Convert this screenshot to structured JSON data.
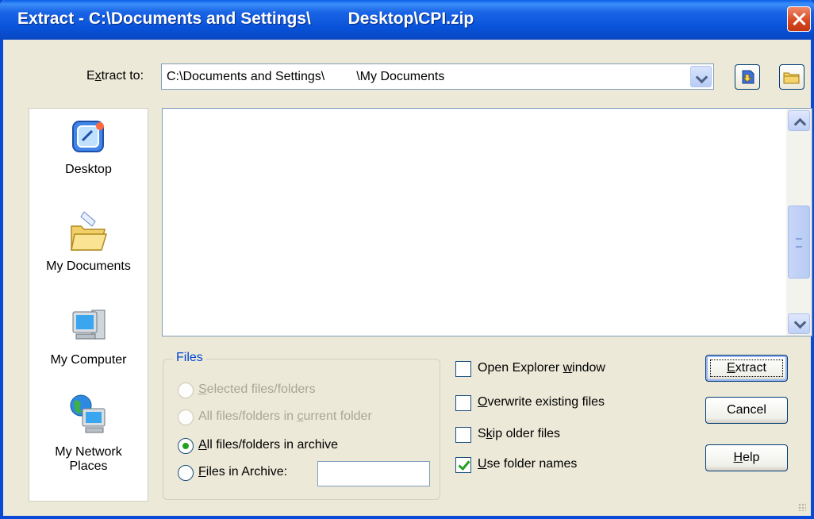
{
  "window": {
    "title": "Extract - C:\\Documents and Settings\\        Desktop\\CPI.zip",
    "close_label": "×"
  },
  "extract_to": {
    "label_pre": "E",
    "label_ul": "x",
    "label_post": "tract to:",
    "value": "C:\\Documents and Settings\\         \\My Documents"
  },
  "toolbar": {
    "up_icon": "up-folder-icon",
    "new_folder_icon": "new-folder-icon"
  },
  "places": [
    {
      "label": "Desktop",
      "icon": "desktop-icon"
    },
    {
      "label": "My Documents",
      "icon": "my-documents-icon"
    },
    {
      "label": "My Computer",
      "icon": "my-computer-icon"
    },
    {
      "label": "My Network\nPlaces",
      "line1": "My Network",
      "line2": "Places",
      "icon": "network-places-icon"
    }
  ],
  "files_group": {
    "legend": "Files",
    "options": [
      {
        "pre": "",
        "ul": "S",
        "post": "elected files/folders",
        "enabled": false,
        "checked": false
      },
      {
        "pre": "All files/folders in ",
        "ul": "c",
        "post": "urrent folder",
        "enabled": false,
        "checked": false
      },
      {
        "pre": "",
        "ul": "A",
        "post": "ll files/folders in archive",
        "enabled": true,
        "checked": true
      },
      {
        "pre": "",
        "ul": "F",
        "post": "iles in Archive:",
        "enabled": true,
        "checked": false
      }
    ],
    "archive_filter_value": ""
  },
  "options": [
    {
      "pre": "Open Explorer ",
      "ul": "w",
      "post": "indow",
      "checked": false
    },
    {
      "pre": "",
      "ul": "O",
      "post": "verwrite existing files",
      "checked": false
    },
    {
      "pre": "S",
      "ul": "k",
      "post": "ip older files",
      "checked": false
    },
    {
      "pre": "",
      "ul": "U",
      "post": "se folder names",
      "checked": true
    }
  ],
  "buttons": {
    "extract": {
      "pre": "",
      "ul": "E",
      "post": "xtract"
    },
    "cancel": {
      "label": "Cancel"
    },
    "help": {
      "pre": "",
      "ul": "H",
      "post": "elp"
    }
  },
  "colors": {
    "titlebar": "#0752d8",
    "legend": "#0046d5",
    "check": "#21a121"
  }
}
